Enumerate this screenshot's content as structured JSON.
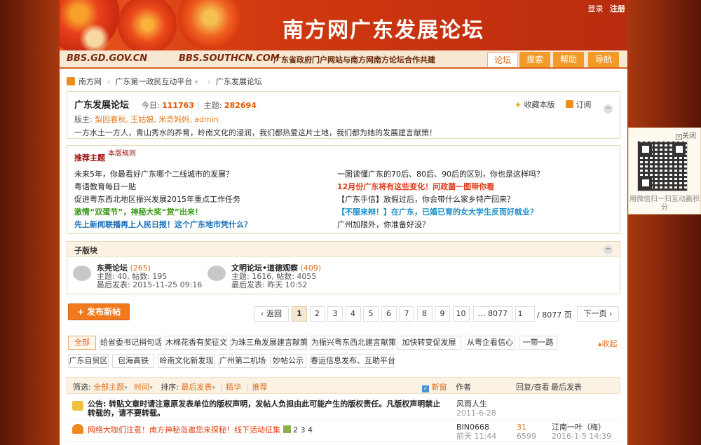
{
  "top_links": {
    "login": "登录",
    "register": "注册"
  },
  "banner": {
    "title": "南方网广东发展论坛"
  },
  "subbar": {
    "url1": "BBS.GD.GOV.CN",
    "url2": "BBS.SOUTHCN.COM",
    "note": "广东省政府门户网站与南方网南方论坛合作共建"
  },
  "nav_tabs": [
    {
      "label": "论坛",
      "active": true
    },
    {
      "label": "搜索",
      "active": false
    },
    {
      "label": "帮助",
      "active": false
    },
    {
      "label": "导航",
      "active": false
    }
  ],
  "breadcrumb": {
    "home": "南方网",
    "level1": "广东第一政民互动平台",
    "level2": "广东发展论坛"
  },
  "forum": {
    "title": "广东发展论坛",
    "today_label": "今日:",
    "today": "111763",
    "topics_label": "主题:",
    "topics": "282694",
    "mods_label": "版主:",
    "mods": "梨园春秋, 王姑娘, 米奇妈妈, admin",
    "description": "一方水土一方人，青山秀水的养育，岭南文化的浸润，我们都热爱这片土地，我们都为她的发展建言献策！",
    "favorite": "收藏本版",
    "subscribe": "订阅"
  },
  "recommend": {
    "title": "推荐主题",
    "rule": "本版规则",
    "left": [
      {
        "text": "未来5年，你最看好广东哪个二线城市的发展？",
        "color": "#222",
        "bold": false
      },
      {
        "text": "粤语教育每日一贴",
        "color": "#222",
        "bold": false
      },
      {
        "text": "促进粤东西北地区振兴发展2015年重点工作任务",
        "color": "#222",
        "bold": false
      },
      {
        "text": "激情“双蛋节”，神秘大奖“赏”出来！",
        "color": "#3a9a1a",
        "bold": true
      },
      {
        "text": "先上新闻联播再上人民日报！这个广东地市凭什么？",
        "color": "#1a6fb8",
        "bold": true
      }
    ],
    "right": [
      {
        "text": "一图读懂广东的70后、80后、90后的区别，你也是这样吗？",
        "color": "#222",
        "bold": false
      },
      {
        "text": "12月份广东将有这些变化！问政菌一图带你看",
        "color": "#e03a1a",
        "bold": true
      },
      {
        "text": "【广东手信】放假过后，你会带什么家乡特产回来？",
        "color": "#222",
        "bold": false
      },
      {
        "text": "【不服来辩！】在广东，已婚已育的女大学生反而好就业？",
        "color": "#1a8fc8",
        "bold": true
      },
      {
        "text": "广州加限外，你准备好没？",
        "color": "#222",
        "bold": false
      }
    ]
  },
  "sub_forums": {
    "title": "子版块",
    "items": [
      {
        "name": "东莞论坛",
        "count": "(265)",
        "stats": "主题: 40, 帖数: 195",
        "last": "最后发表: 2015-11-25 09:16"
      },
      {
        "name": "文明论坛•道德观察",
        "count": "(409)",
        "stats": "主题: 1616, 帖数: 4055",
        "last": "最后发表: 昨天 10:52"
      }
    ]
  },
  "post_button": "发布新帖",
  "pager": {
    "prev": "返回",
    "pages": [
      "1",
      "2",
      "3",
      "4",
      "5",
      "6",
      "7",
      "8",
      "9",
      "10"
    ],
    "last": "... 8077",
    "input": "1",
    "total": "/ 8077 页",
    "next": "下一页"
  },
  "tags_row1": [
    "全部",
    "给省委书记捎句话",
    "木棉花香有奖征文",
    "为珠三角发展建言献策",
    "为振兴粤东西北建言献策",
    "加快转变促发展",
    "从粤企看信心",
    "一带一路"
  ],
  "tags_row2": [
    "广东自贸区",
    "包海高铁",
    "岭南文化新发现",
    "广州第二机场",
    "妙帖公示",
    "春运信息发布、互助平台"
  ],
  "collapse": "收起",
  "filter": {
    "label": "筛选:",
    "all_topics": "全部主题",
    "time": "时间",
    "sort_label": "排序:",
    "last_post": "最后发表",
    "digest": "精华",
    "recommend": "推荐",
    "new_window": "新窗",
    "col_author": "作者",
    "col_reply": "回复/查看",
    "col_last": "最后发表"
  },
  "threads": [
    {
      "title": "公告: 转贴文章时请注意原发表单位的版权声明，发帖人负担由此可能产生的版权责任。凡版权声明禁止转载的，请不要转载。",
      "author": "风雨人生",
      "date": "2011-6-28",
      "replies": "",
      "views": "",
      "last_user": "",
      "last_time": ""
    },
    {
      "title": "网络大咖们注意！南方神秘岛邀您来探秘！线下活动征集",
      "pages": "2 3 4",
      "author": "BIN0668",
      "date": "前天 11:44",
      "replies": "31",
      "views": "6599",
      "last_user": "江南一叶（梅）",
      "last_time": "2016-1-5 14:39"
    }
  ],
  "qr_panel": {
    "close": "关闭",
    "text": "用微信扫一扫互动赢积分"
  }
}
